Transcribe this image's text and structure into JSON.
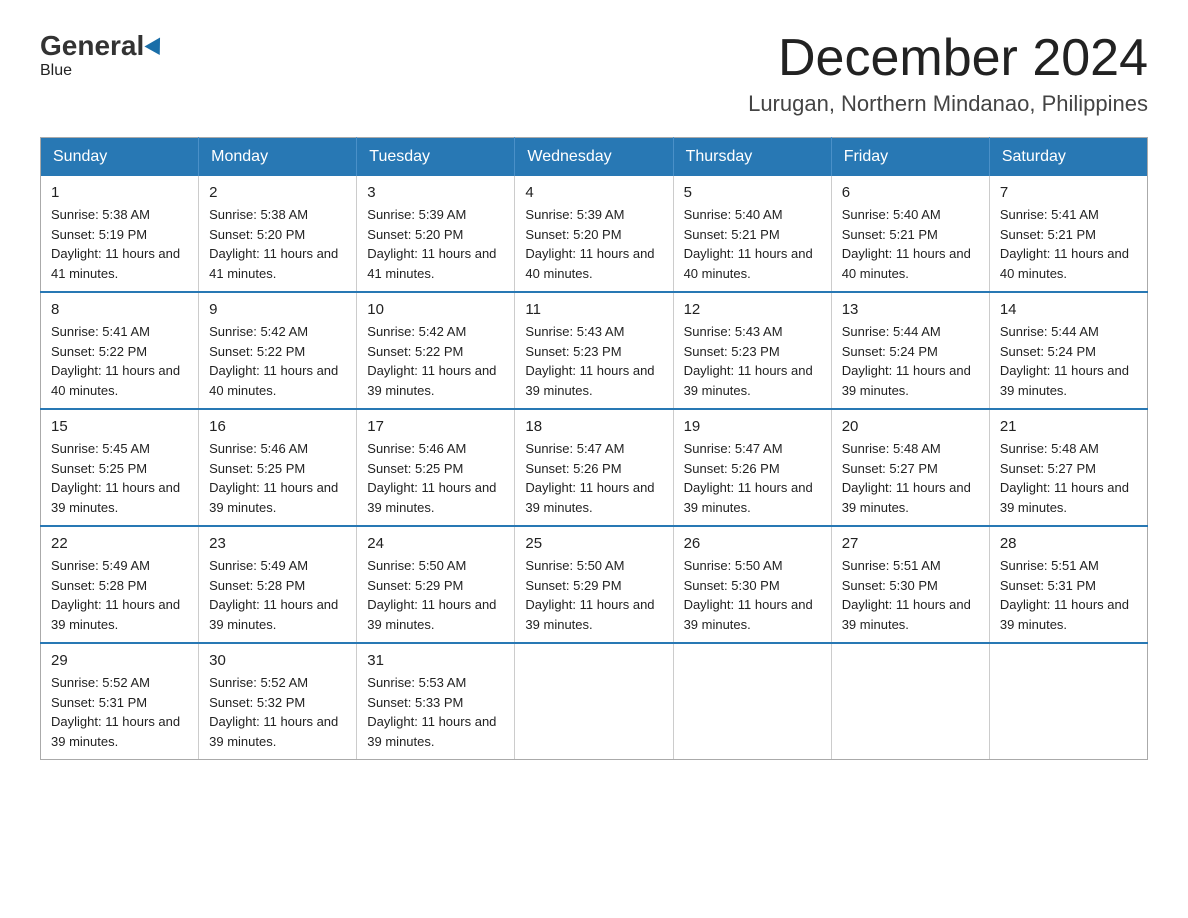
{
  "logo": {
    "general": "General",
    "blue": "Blue"
  },
  "header": {
    "month": "December 2024",
    "location": "Lurugan, Northern Mindanao, Philippines"
  },
  "weekdays": [
    "Sunday",
    "Monday",
    "Tuesday",
    "Wednesday",
    "Thursday",
    "Friday",
    "Saturday"
  ],
  "weeks": [
    [
      {
        "day": "1",
        "sunrise": "5:38 AM",
        "sunset": "5:19 PM",
        "daylight": "11 hours and 41 minutes."
      },
      {
        "day": "2",
        "sunrise": "5:38 AM",
        "sunset": "5:20 PM",
        "daylight": "11 hours and 41 minutes."
      },
      {
        "day": "3",
        "sunrise": "5:39 AM",
        "sunset": "5:20 PM",
        "daylight": "11 hours and 41 minutes."
      },
      {
        "day": "4",
        "sunrise": "5:39 AM",
        "sunset": "5:20 PM",
        "daylight": "11 hours and 40 minutes."
      },
      {
        "day": "5",
        "sunrise": "5:40 AM",
        "sunset": "5:21 PM",
        "daylight": "11 hours and 40 minutes."
      },
      {
        "day": "6",
        "sunrise": "5:40 AM",
        "sunset": "5:21 PM",
        "daylight": "11 hours and 40 minutes."
      },
      {
        "day": "7",
        "sunrise": "5:41 AM",
        "sunset": "5:21 PM",
        "daylight": "11 hours and 40 minutes."
      }
    ],
    [
      {
        "day": "8",
        "sunrise": "5:41 AM",
        "sunset": "5:22 PM",
        "daylight": "11 hours and 40 minutes."
      },
      {
        "day": "9",
        "sunrise": "5:42 AM",
        "sunset": "5:22 PM",
        "daylight": "11 hours and 40 minutes."
      },
      {
        "day": "10",
        "sunrise": "5:42 AM",
        "sunset": "5:22 PM",
        "daylight": "11 hours and 39 minutes."
      },
      {
        "day": "11",
        "sunrise": "5:43 AM",
        "sunset": "5:23 PM",
        "daylight": "11 hours and 39 minutes."
      },
      {
        "day": "12",
        "sunrise": "5:43 AM",
        "sunset": "5:23 PM",
        "daylight": "11 hours and 39 minutes."
      },
      {
        "day": "13",
        "sunrise": "5:44 AM",
        "sunset": "5:24 PM",
        "daylight": "11 hours and 39 minutes."
      },
      {
        "day": "14",
        "sunrise": "5:44 AM",
        "sunset": "5:24 PM",
        "daylight": "11 hours and 39 minutes."
      }
    ],
    [
      {
        "day": "15",
        "sunrise": "5:45 AM",
        "sunset": "5:25 PM",
        "daylight": "11 hours and 39 minutes."
      },
      {
        "day": "16",
        "sunrise": "5:46 AM",
        "sunset": "5:25 PM",
        "daylight": "11 hours and 39 minutes."
      },
      {
        "day": "17",
        "sunrise": "5:46 AM",
        "sunset": "5:25 PM",
        "daylight": "11 hours and 39 minutes."
      },
      {
        "day": "18",
        "sunrise": "5:47 AM",
        "sunset": "5:26 PM",
        "daylight": "11 hours and 39 minutes."
      },
      {
        "day": "19",
        "sunrise": "5:47 AM",
        "sunset": "5:26 PM",
        "daylight": "11 hours and 39 minutes."
      },
      {
        "day": "20",
        "sunrise": "5:48 AM",
        "sunset": "5:27 PM",
        "daylight": "11 hours and 39 minutes."
      },
      {
        "day": "21",
        "sunrise": "5:48 AM",
        "sunset": "5:27 PM",
        "daylight": "11 hours and 39 minutes."
      }
    ],
    [
      {
        "day": "22",
        "sunrise": "5:49 AM",
        "sunset": "5:28 PM",
        "daylight": "11 hours and 39 minutes."
      },
      {
        "day": "23",
        "sunrise": "5:49 AM",
        "sunset": "5:28 PM",
        "daylight": "11 hours and 39 minutes."
      },
      {
        "day": "24",
        "sunrise": "5:50 AM",
        "sunset": "5:29 PM",
        "daylight": "11 hours and 39 minutes."
      },
      {
        "day": "25",
        "sunrise": "5:50 AM",
        "sunset": "5:29 PM",
        "daylight": "11 hours and 39 minutes."
      },
      {
        "day": "26",
        "sunrise": "5:50 AM",
        "sunset": "5:30 PM",
        "daylight": "11 hours and 39 minutes."
      },
      {
        "day": "27",
        "sunrise": "5:51 AM",
        "sunset": "5:30 PM",
        "daylight": "11 hours and 39 minutes."
      },
      {
        "day": "28",
        "sunrise": "5:51 AM",
        "sunset": "5:31 PM",
        "daylight": "11 hours and 39 minutes."
      }
    ],
    [
      {
        "day": "29",
        "sunrise": "5:52 AM",
        "sunset": "5:31 PM",
        "daylight": "11 hours and 39 minutes."
      },
      {
        "day": "30",
        "sunrise": "5:52 AM",
        "sunset": "5:32 PM",
        "daylight": "11 hours and 39 minutes."
      },
      {
        "day": "31",
        "sunrise": "5:53 AM",
        "sunset": "5:33 PM",
        "daylight": "11 hours and 39 minutes."
      },
      null,
      null,
      null,
      null
    ]
  ],
  "labels": {
    "sunrise": "Sunrise:",
    "sunset": "Sunset:",
    "daylight": "Daylight:"
  }
}
